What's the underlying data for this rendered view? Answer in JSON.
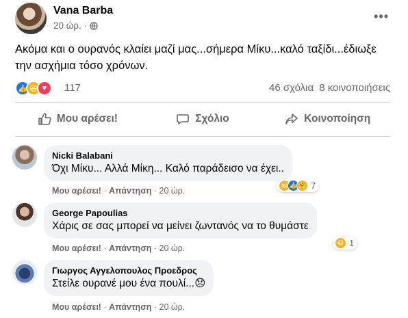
{
  "post": {
    "author": "Vana Barba",
    "time": "20 ώρ.",
    "text": "Ακόμα και ο ουρανός κλαίει μαζί μας...σήμερα Μίκυ...καλό ταξίδι...έδιωξε την ασχήμια τόσο χρόνων.",
    "reactions_count": "117",
    "comments_count": "46 σχόλια",
    "shares_count": "8 κοινοποιήσεις"
  },
  "actions": {
    "like": "Μου αρέσει!",
    "comment": "Σχόλιο",
    "share": "Κοινοποίηση"
  },
  "comments": [
    {
      "name": "Nicki Balabani",
      "text": "Όχι Μίκυ... Αλλά Μίκη... Καλό παράδεισο να έχει..",
      "like_label": "Μου αρέσει!",
      "reply_label": "Απάντηση",
      "time": "20 ώρ.",
      "reactions_count": "7",
      "reactions": [
        "haha",
        "like",
        "care"
      ]
    },
    {
      "name": "George Papoulias",
      "text": "Χάρις σε σας μπορεί να μείνει ζωντανός να το θυμάστε",
      "like_label": "Μου αρέσει!",
      "reply_label": "Απάντηση",
      "time": "20 ώρ.",
      "reactions_count": "1",
      "reactions": [
        "haha"
      ]
    },
    {
      "name": "Γιωργος Αγγελοπουλος Προεδρος",
      "text": "Στείλε ουρανέ μου ένα πουλί...😞",
      "like_label": "Μου αρέσει!",
      "reply_label": "Απάντηση",
      "time": "20 ώρ."
    }
  ],
  "colors": {
    "like_blue": "#1877f2",
    "haha_yellow": "#f7b125",
    "love_red": "#f33e58",
    "secondary_text": "#65676b",
    "bubble_bg": "#f0f2f5"
  },
  "icons": [
    "globe-icon",
    "more-icon",
    "like-icon",
    "comment-icon",
    "share-icon"
  ]
}
